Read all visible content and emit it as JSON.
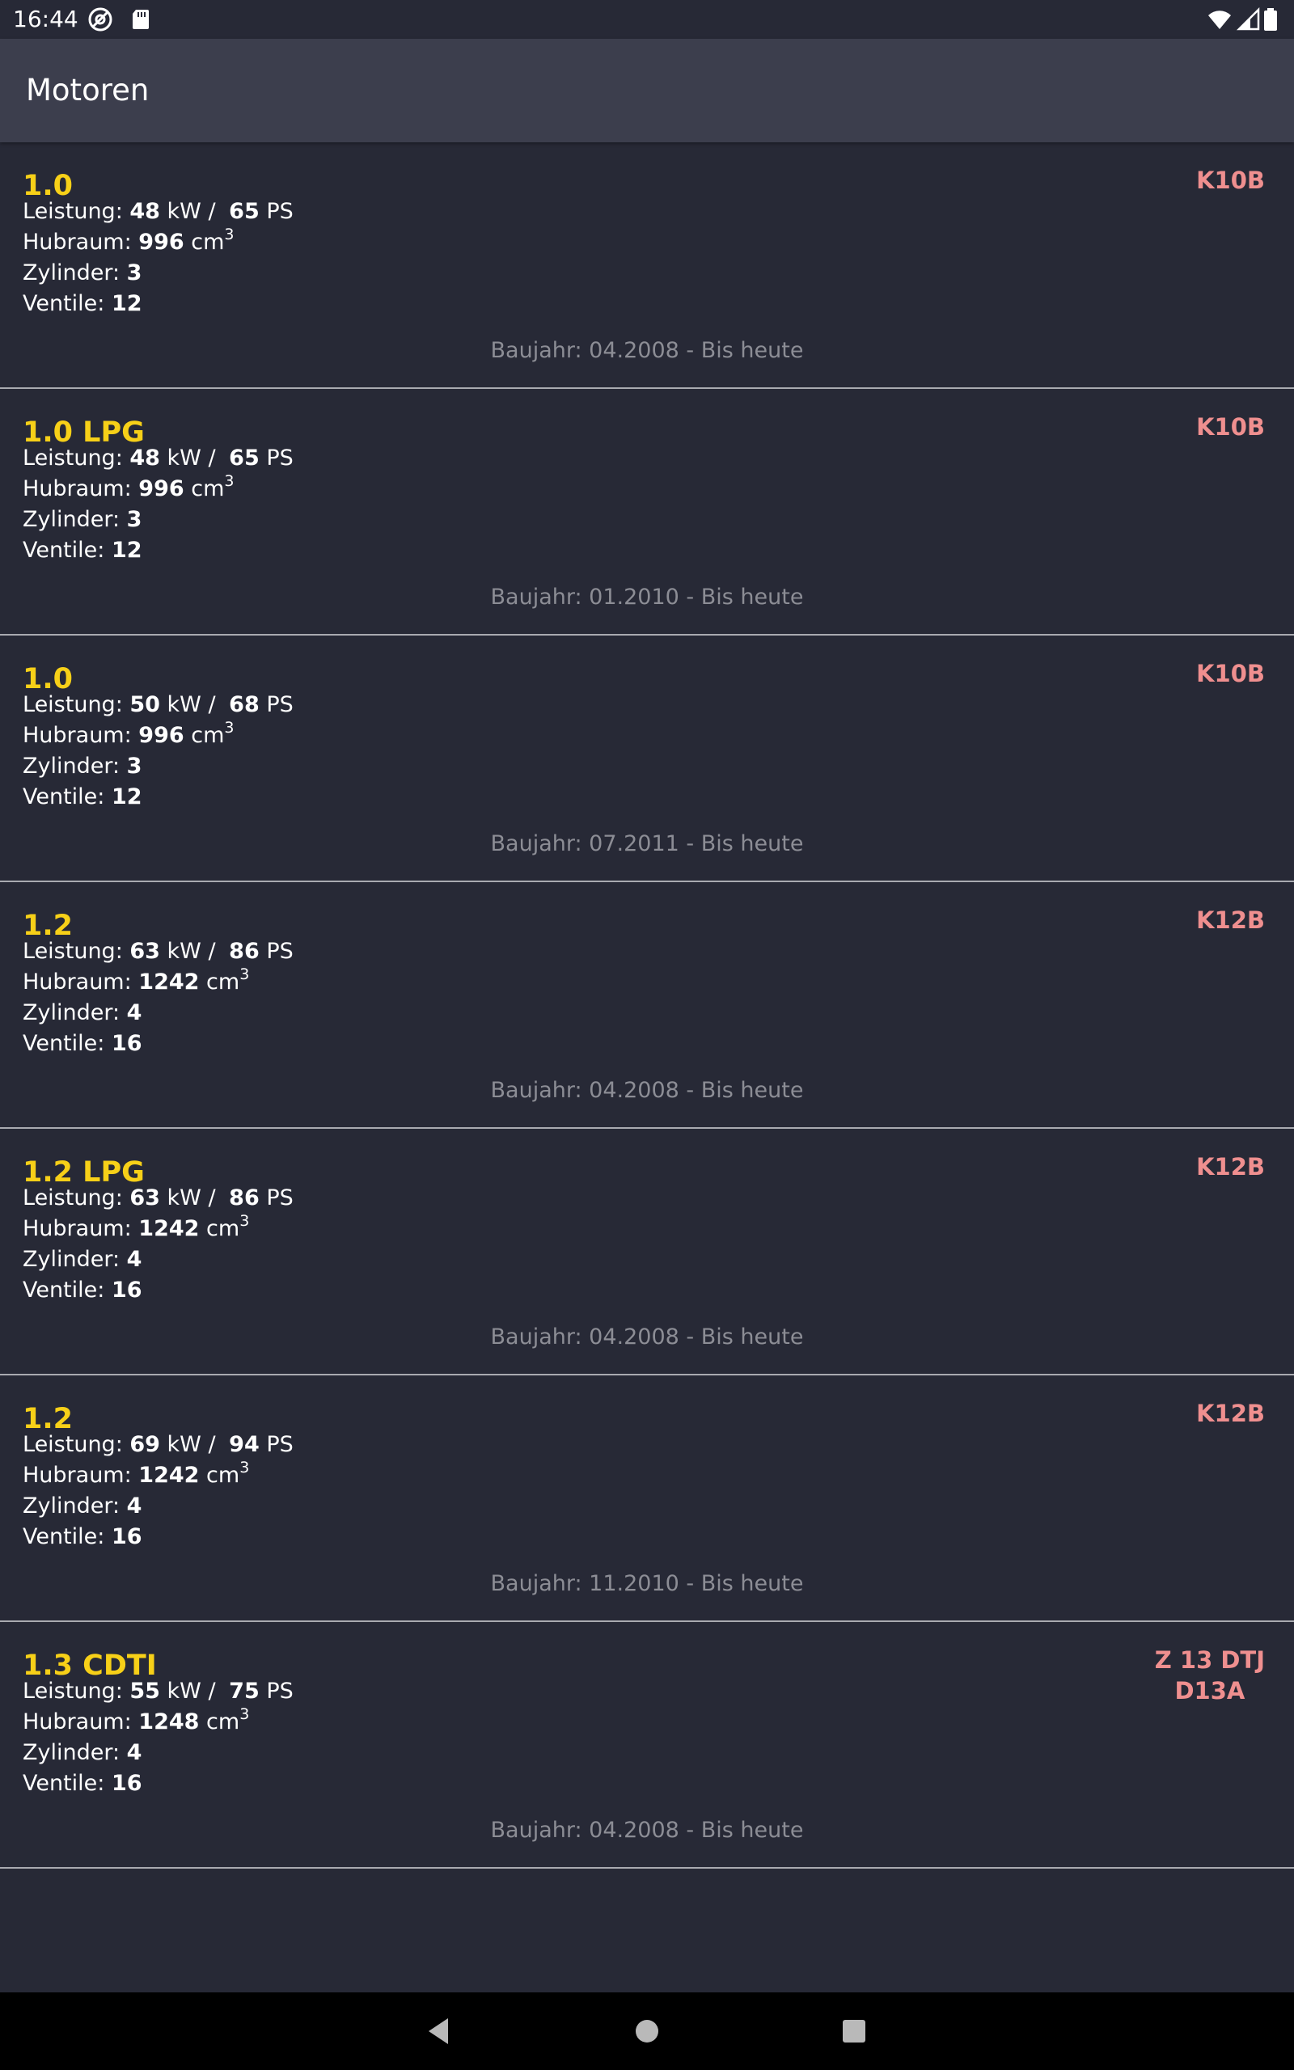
{
  "status_bar": {
    "time": "16:44",
    "left_icons": [
      "at-sign-icon",
      "sd-card-icon"
    ],
    "right_icons": [
      "wifi-icon",
      "cell-signal-icon",
      "battery-icon"
    ]
  },
  "app_bar": {
    "title": "Motoren"
  },
  "labels": {
    "leistung": "Leistung: ",
    "kw": " kW / ",
    "ps": " PS",
    "hubraum": "Hubraum: ",
    "cm": " cm",
    "cm_sup": "3",
    "zylinder": "Zylinder: ",
    "ventile": "Ventile: "
  },
  "engines": [
    {
      "name": "1.0",
      "codes": [
        "K10B"
      ],
      "kw": "48",
      "ps": "65",
      "hubraum": "996",
      "zylinder": "3",
      "ventile": "12",
      "baujahr": "Baujahr: 04.2008 - Bis heute"
    },
    {
      "name": "1.0 LPG",
      "codes": [
        "K10B"
      ],
      "kw": "48",
      "ps": "65",
      "hubraum": "996",
      "zylinder": "3",
      "ventile": "12",
      "baujahr": "Baujahr: 01.2010 - Bis heute"
    },
    {
      "name": "1.0",
      "codes": [
        "K10B"
      ],
      "kw": "50",
      "ps": "68",
      "hubraum": "996",
      "zylinder": "3",
      "ventile": "12",
      "baujahr": "Baujahr: 07.2011 - Bis heute"
    },
    {
      "name": "1.2",
      "codes": [
        "K12B"
      ],
      "kw": "63",
      "ps": "86",
      "hubraum": "1242",
      "zylinder": "4",
      "ventile": "16",
      "baujahr": "Baujahr: 04.2008 - Bis heute"
    },
    {
      "name": "1.2 LPG",
      "codes": [
        "K12B"
      ],
      "kw": "63",
      "ps": "86",
      "hubraum": "1242",
      "zylinder": "4",
      "ventile": "16",
      "baujahr": "Baujahr: 04.2008 - Bis heute"
    },
    {
      "name": "1.2",
      "codes": [
        "K12B"
      ],
      "kw": "69",
      "ps": "94",
      "hubraum": "1242",
      "zylinder": "4",
      "ventile": "16",
      "baujahr": "Baujahr: 11.2010 - Bis heute"
    },
    {
      "name": "1.3 CDTI",
      "codes": [
        "Z 13 DTJ",
        "D13A"
      ],
      "kw": "55",
      "ps": "75",
      "hubraum": "1248",
      "zylinder": "4",
      "ventile": "16",
      "baujahr": "Baujahr: 04.2008 - Bis heute"
    }
  ],
  "nav_bar": {
    "buttons": [
      "back-icon",
      "home-icon",
      "recents-icon"
    ]
  },
  "colors": {
    "background": "#272936",
    "app_bar": "#3c3e4d",
    "engine_name": "#f7d018",
    "engine_code": "#ef8f8f",
    "baujahr": "#8c8d95",
    "divider": "#a9aab0"
  }
}
